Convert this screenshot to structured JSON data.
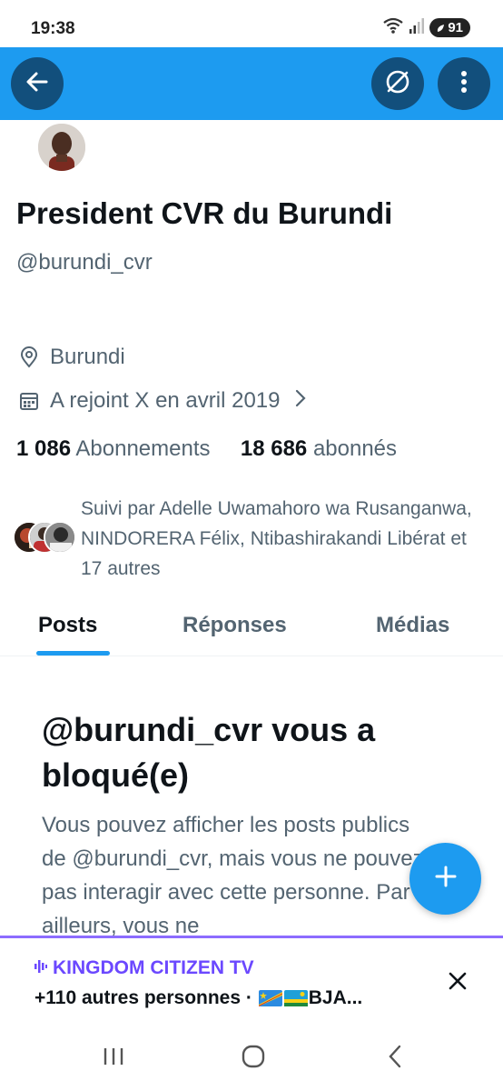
{
  "status_bar": {
    "time": "19:38",
    "battery": "91",
    "icons": [
      "wifi-icon",
      "signal-icon",
      "battery-icon"
    ]
  },
  "header": {
    "back_icon": "arrow-left-icon",
    "cross_icon": "no-entry-icon",
    "more_icon": "more-vertical-icon",
    "color": "#1d9bf0"
  },
  "profile": {
    "display_name": "President CVR du Burundi",
    "handle": "@burundi_cvr",
    "location": "Burundi",
    "joined": "A rejoint X en avril 2019",
    "following_count": "1 086",
    "following_label": "Abonnements",
    "followers_count": "18 686",
    "followers_label": "abonnés",
    "followed_by": "Suivi par Adelle Uwamahoro wa Rusanganwa, NINDORERA Félix, Ntibashirakandi Libérat et 17 autres"
  },
  "tabs": [
    {
      "label": "Posts",
      "active": true
    },
    {
      "label": "Réponses",
      "active": false
    },
    {
      "label": "Médias",
      "active": false
    }
  ],
  "blocked": {
    "title": "@burundi_cvr vous a bloqué(e)",
    "text": "Vous pouvez afficher les posts publics de @burundi_cvr, mais vous ne pouvez pas interagir avec cette personne. Par ailleurs, vous ne"
  },
  "fab_icon": "plus-icon",
  "space": {
    "title": "KINGDOM CITIZEN TV",
    "subtitle": "+110 autres personnes · ",
    "subtitle_tail": "BJA...",
    "accent": "#6b48ff"
  },
  "nav": {
    "icons": [
      "recent-apps-icon",
      "home-icon",
      "back-icon"
    ]
  }
}
